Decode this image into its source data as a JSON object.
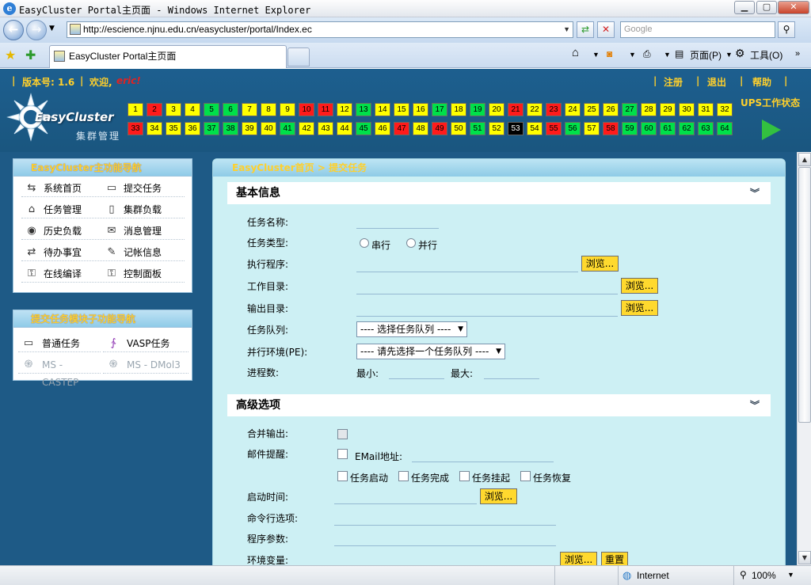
{
  "window": {
    "title": "EasyCluster Portal主页面 - Windows Internet Explorer",
    "url": "http://escience.njnu.edu.cn/easycluster/portal/Index.ec",
    "search_placeholder": "Google",
    "tab_title": "EasyCluster Portal主页面",
    "commands": {
      "page": "页面(P)",
      "tools": "工具(O)"
    },
    "controls": {
      "minimize": "▁",
      "maximize": "▢",
      "close": "✕"
    }
  },
  "header": {
    "version": "版本号: 1.6",
    "welcome": "欢迎,",
    "user": "eric!",
    "links": {
      "register": "注册",
      "logout": "退出",
      "help": "帮助"
    },
    "logo_text": "EasyCluster",
    "logo_sub": "集群管理",
    "ups_label": "UPS工作状态",
    "nodes_row1": [
      {
        "n": "1",
        "s": "y"
      },
      {
        "n": "2",
        "s": "r"
      },
      {
        "n": "3",
        "s": "y"
      },
      {
        "n": "4",
        "s": "y"
      },
      {
        "n": "5",
        "s": "g"
      },
      {
        "n": "6",
        "s": "g"
      },
      {
        "n": "7",
        "s": "y"
      },
      {
        "n": "8",
        "s": "y"
      },
      {
        "n": "9",
        "s": "y"
      },
      {
        "n": "10",
        "s": "r"
      },
      {
        "n": "11",
        "s": "r"
      },
      {
        "n": "12",
        "s": "y"
      },
      {
        "n": "13",
        "s": "g"
      },
      {
        "n": "14",
        "s": "y"
      },
      {
        "n": "15",
        "s": "y"
      },
      {
        "n": "16",
        "s": "y"
      },
      {
        "n": "17",
        "s": "g"
      },
      {
        "n": "18",
        "s": "y"
      },
      {
        "n": "19",
        "s": "g"
      },
      {
        "n": "20",
        "s": "y"
      },
      {
        "n": "21",
        "s": "r"
      },
      {
        "n": "22",
        "s": "y"
      },
      {
        "n": "23",
        "s": "r"
      },
      {
        "n": "24",
        "s": "y"
      },
      {
        "n": "25",
        "s": "y"
      },
      {
        "n": "26",
        "s": "y"
      },
      {
        "n": "27",
        "s": "g"
      },
      {
        "n": "28",
        "s": "y"
      },
      {
        "n": "29",
        "s": "y"
      },
      {
        "n": "30",
        "s": "y"
      },
      {
        "n": "31",
        "s": "y"
      },
      {
        "n": "32",
        "s": "y"
      }
    ],
    "nodes_row2": [
      {
        "n": "33",
        "s": "r"
      },
      {
        "n": "34",
        "s": "y"
      },
      {
        "n": "35",
        "s": "y"
      },
      {
        "n": "36",
        "s": "y"
      },
      {
        "n": "37",
        "s": "g"
      },
      {
        "n": "38",
        "s": "g"
      },
      {
        "n": "39",
        "s": "y"
      },
      {
        "n": "40",
        "s": "y"
      },
      {
        "n": "41",
        "s": "g"
      },
      {
        "n": "42",
        "s": "y"
      },
      {
        "n": "43",
        "s": "y"
      },
      {
        "n": "44",
        "s": "y"
      },
      {
        "n": "45",
        "s": "g"
      },
      {
        "n": "46",
        "s": "y"
      },
      {
        "n": "47",
        "s": "r"
      },
      {
        "n": "48",
        "s": "y"
      },
      {
        "n": "49",
        "s": "r"
      },
      {
        "n": "50",
        "s": "y"
      },
      {
        "n": "51",
        "s": "g"
      },
      {
        "n": "52",
        "s": "y"
      },
      {
        "n": "53",
        "s": "k"
      },
      {
        "n": "54",
        "s": "y"
      },
      {
        "n": "55",
        "s": "r"
      },
      {
        "n": "56",
        "s": "g"
      },
      {
        "n": "57",
        "s": "y"
      },
      {
        "n": "58",
        "s": "r"
      },
      {
        "n": "59",
        "s": "g"
      },
      {
        "n": "60",
        "s": "g"
      },
      {
        "n": "61",
        "s": "g"
      },
      {
        "n": "62",
        "s": "g"
      },
      {
        "n": "63",
        "s": "g"
      },
      {
        "n": "64",
        "s": "g"
      }
    ]
  },
  "main_nav": {
    "title": "EasyCluster主功能导航",
    "items": [
      {
        "label": "系统首页",
        "icon": "home-icon",
        "glyph": "⇆"
      },
      {
        "label": "提交任务",
        "icon": "submit-task-icon",
        "glyph": "▭"
      },
      {
        "label": "任务管理",
        "icon": "task-manage-icon",
        "glyph": "⌂"
      },
      {
        "label": "集群负载",
        "icon": "cluster-load-icon",
        "glyph": "▯"
      },
      {
        "label": "历史负载",
        "icon": "history-load-icon",
        "glyph": "◉"
      },
      {
        "label": "消息管理",
        "icon": "mail-icon",
        "glyph": "✉"
      },
      {
        "label": "待办事宜",
        "icon": "todo-icon",
        "glyph": "⇄"
      },
      {
        "label": "记帐信息",
        "icon": "accounting-icon",
        "glyph": "✎"
      },
      {
        "label": "在线编译",
        "icon": "compile-icon",
        "glyph": "⚿"
      },
      {
        "label": "控制面板",
        "icon": "control-panel-icon",
        "glyph": "⚿"
      }
    ]
  },
  "sub_nav": {
    "title": "提交任务模块子功能导航",
    "items": [
      {
        "label": "普通任务",
        "icon": "normal-task-icon",
        "glyph": "▭",
        "enabled": true
      },
      {
        "label": "VASP任务",
        "icon": "vasp-task-icon",
        "glyph": "∱",
        "enabled": true
      },
      {
        "label": "MS - CASTEP",
        "icon": "castep-icon",
        "glyph": "֍",
        "enabled": false
      },
      {
        "label": "MS - DMol3",
        "icon": "dmol3-icon",
        "glyph": "֍",
        "enabled": false
      }
    ]
  },
  "content": {
    "breadcrumb": "EasyCluster首页   > 提交任务",
    "basic": {
      "title": "基本信息",
      "task_name": "任务名称:",
      "task_type": "任务类型:",
      "serial": "串行",
      "parallel": "并行",
      "executable": "执行程序:",
      "work_dir": "工作目录:",
      "output_dir": "输出目录:",
      "queue": "任务队列:",
      "queue_select": "---- 选择任务队列 ----",
      "pe": "并行环境(PE):",
      "pe_select": "---- 请先选择一个任务队列 ----",
      "procs": "进程数:",
      "min": "最小:",
      "max": "最大:",
      "browse": "浏览..."
    },
    "advanced": {
      "title": "高级选项",
      "merge_output": "合并输出:",
      "mail_notify": "邮件提醒:",
      "email_addr": "EMail地址:",
      "opt_start": "任务启动",
      "opt_finish": "任务完成",
      "opt_suspend": "任务挂起",
      "opt_resume": "任务恢复",
      "start_time": "启动时间:",
      "cmd_options": "命令行选项:",
      "prog_params": "程序参数:",
      "env_vars": "环境变量:",
      "browse": "浏览...",
      "reset": "重置"
    }
  },
  "status": {
    "zone": "Internet",
    "zoom": "100%"
  }
}
